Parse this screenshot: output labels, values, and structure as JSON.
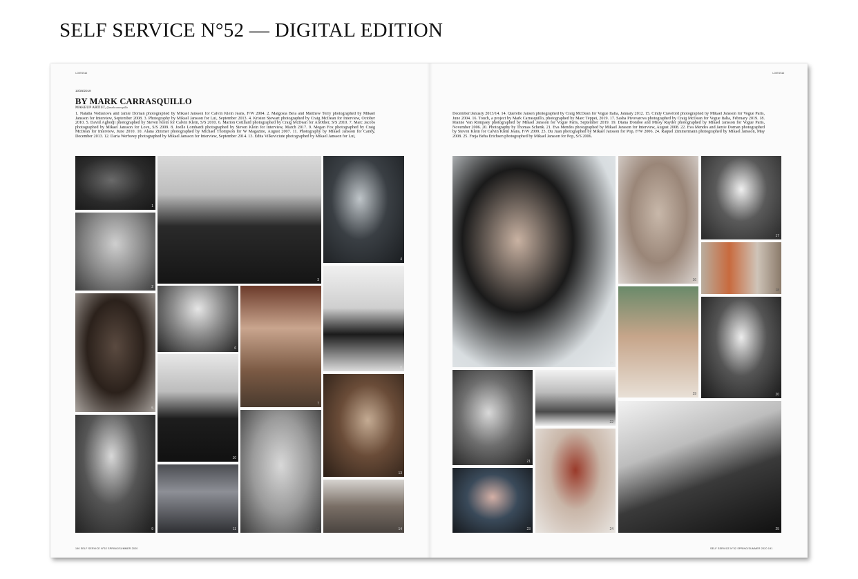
{
  "page_title": "SELF SERVICE N°52 — DIGITAL EDITION",
  "left_page": {
    "running_head": "i-D/ESSAI",
    "date": "10/25/2019",
    "byline": "BY MARK CARRASQUILLO",
    "role": "MAKEUP ARTIST,",
    "handle": "@markcarrasquillo",
    "credits": "1. Natalia Vodianova and Jamie Dornan photographed by Mikael Jansson for Calvin Klein Jeans, F/W 2004. 2. Malgosia Bela and Matthew Terry photographed by Mikael Jansson for Interview, September 2008. 3. Photography by Mikael Jansson for Lui, September 2013. 4. Kristen Stewart photographed by Craig McDean for Interview, October 2010. 5. David Agbodji photographed by Steven Klein for Calvin Klein, S/S 2010. 6. Marion Cotillard photographed by Craig McDean for AnOther, S/S 2010. 7. Marc Jacobs photographed by Mikael Jansson for Love, S/S 2009. 8. Joelle Lombardi photographed by Steven Klein for Interview, March 2017. 9. Megan Fox photographed by Craig McDean for Interview, June 2010. 10. Alana Zimmer photographed by Michael Thompson for W Magazine, August 2007. 11. Photography by Mikael Jansson for Candy, December 2013. 12. Daria Werbowy photographed by Mikael Jansson for Interview, September 2014. 13. Edita Vilkeviciute photographed by Mikael Jansson for Lui,",
    "folio": "190   SELF SERVICE N°52 SPRING/SUMMER 2020"
  },
  "right_page": {
    "running_head": "i-D/ESSAI",
    "credits": "December/January 2013/14. 14. Querelle Jansen photographed by Craig McDean for Vogue Italia, January 2012. 15. Cindy Crawford photographed by Mikael Jansson for Vogue Paris, June 2004. 16. Touch, a project by Mark Carrasquillo, photographed by Marc Teppei, 2019. 17. Sasha Pivovarova photographed by Craig McDean for Vogue Italia, February 2019. 18. Rianne Van Rompaey photographed by Mikael Jansson for Vogue Paris, September 2019. 19. Diana Dondoe and Missy Rayder photographed by Mikael Jansson for Vogue Paris, November 2006. 20. Photography by Thomas Schenk. 21. Eva Mendes photographed by Mikael Jansson for Interview, August 2008. 22. Eva Mendes and Jamie Dornan photographed by Steven Klein for Calvin Klein Jeans, F/W 2009. 23. Du Juan photographed by Mikael Jansson for Pop, F/W 2006. 24. Raquel Zimmermann photographed by Mikael Jansson, May 2008. 25. Freja Beha Erichsen photographed by Mikael Jansson for Pop, S/S 2006.",
    "folio": "SELF SERVICE N°52 SPRING/SUMMER 2020   191"
  },
  "photos": [
    {
      "num": "1",
      "tone": "g1"
    },
    {
      "num": "2",
      "tone": "g2"
    },
    {
      "num": "3",
      "tone": "g3"
    },
    {
      "num": "4",
      "tone": "g4"
    },
    {
      "num": "5",
      "tone": "g5"
    },
    {
      "num": "6",
      "tone": "g6"
    },
    {
      "num": "7",
      "tone": "g7"
    },
    {
      "num": "8",
      "tone": "g8"
    },
    {
      "num": "9",
      "tone": "g9"
    },
    {
      "num": "10",
      "tone": "g10"
    },
    {
      "num": "11",
      "tone": "g13"
    },
    {
      "num": "12",
      "tone": "g12"
    },
    {
      "num": "13",
      "tone": "g11"
    },
    {
      "num": "14",
      "tone": "g14"
    },
    {
      "num": "15",
      "tone": "g15"
    },
    {
      "num": "16",
      "tone": "g16"
    },
    {
      "num": "17",
      "tone": "g17"
    },
    {
      "num": "18",
      "tone": "g18"
    },
    {
      "num": "19",
      "tone": "g19"
    },
    {
      "num": "20",
      "tone": "g20"
    },
    {
      "num": "21",
      "tone": "g21"
    },
    {
      "num": "22",
      "tone": "g22"
    },
    {
      "num": "23",
      "tone": "g23"
    },
    {
      "num": "24",
      "tone": "g24"
    },
    {
      "num": "25",
      "tone": "g25"
    }
  ]
}
